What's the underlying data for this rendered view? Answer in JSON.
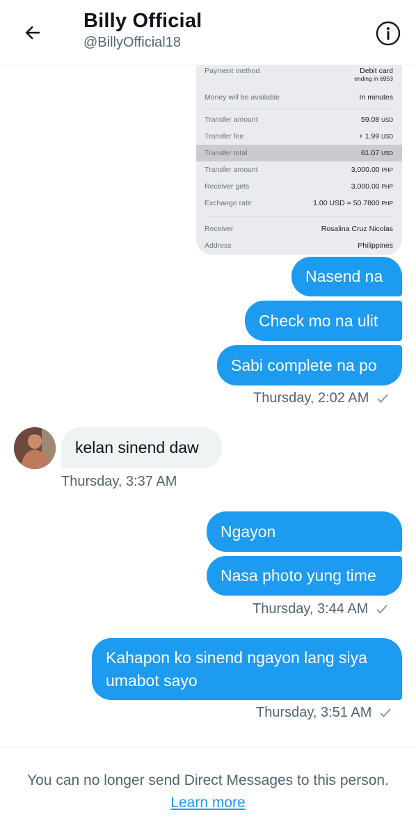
{
  "header": {
    "title": "Billy Official",
    "handle": "@BillyOfficial18",
    "back_icon": "arrow-left-icon",
    "info_icon": "info-icon"
  },
  "receipt": {
    "payment_method": {
      "label": "Payment method",
      "value": "Debit card",
      "sub": "ending in 6953"
    },
    "available": {
      "label": "Money will be available",
      "value": "In minutes"
    },
    "transfer_amount_usd": {
      "label": "Transfer amount",
      "value": "59.08",
      "currency": "USD"
    },
    "transfer_fee": {
      "label": "Transfer fee",
      "value": "+ 1.99",
      "currency": "USD"
    },
    "transfer_total": {
      "label": "Transfer total",
      "value": "61.07",
      "currency": "USD"
    },
    "transfer_amount_php": {
      "label": "Transfer amount",
      "value": "3,000.00",
      "currency": "PHP"
    },
    "receiver_gets": {
      "label": "Receiver gets",
      "value": "3,000.00",
      "currency": "PHP"
    },
    "exchange_rate": {
      "label": "Exchange rate",
      "value": "1.00 USD = 50.7800",
      "currency": "PHP"
    },
    "receiver": {
      "label": "Receiver",
      "value": "Rosalina Cruz Nicolas"
    },
    "address": {
      "label": "Address",
      "value": "Philippines"
    }
  },
  "messages": {
    "m1": "Nasend na",
    "m2": "Check mo na ulit",
    "m3": "Sabi complete na po",
    "ts1": "Thursday, 2:02 AM",
    "in1": "kelan sinend daw",
    "ts_in1": "Thursday, 3:37 AM",
    "m4": "Ngayon",
    "m5": "Nasa photo yung time",
    "ts2": "Thursday, 3:44 AM",
    "m6_line1": "Kahapon ko sinend ngayon lang siya",
    "m6_line2": "umabot sayo",
    "ts3": "Thursday, 3:51 AM"
  },
  "footer": {
    "notice": "You can no longer send Direct Messages to this person.",
    "link": "Learn more"
  },
  "colors": {
    "accent": "#1d9bf0",
    "incoming_bubble": "#eff3f4",
    "secondary_text": "#536471"
  }
}
